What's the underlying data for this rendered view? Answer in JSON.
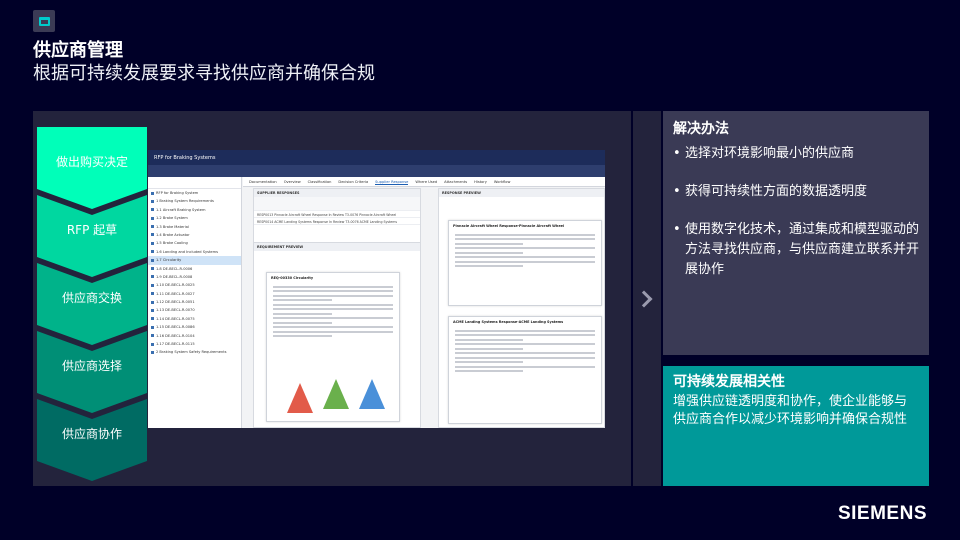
{
  "header": {
    "title": "供应商管理",
    "subtitle": "根据可持续发展要求寻找供应商并确保合规"
  },
  "process_steps": [
    {
      "label": "做出购买决定",
      "color": "#00ffb9"
    },
    {
      "label": "RFP 起草",
      "color": "#00d7a0"
    },
    {
      "label": "供应商交换",
      "color": "#00b38a"
    },
    {
      "label": "供应商选择",
      "color": "#008f76"
    },
    {
      "label": "供应商协作",
      "color": "#006b63"
    }
  ],
  "screenshot": {
    "app_title": "RFP for Braking Systems",
    "tabs": [
      "Documentation",
      "Overview",
      "Classification",
      "Decision Criteria",
      "Supplier Response",
      "Where Used",
      "Attachments",
      "History",
      "Workflow"
    ],
    "active_tab": "Supplier Response",
    "tree_items": [
      "RFP for Braking System",
      "1 Braking System Requirements",
      "1.1 Aircraft Braking System",
      "1.2 Brake System",
      "1.3 Brake Material",
      "1.4 Brake Actuator",
      "1.5 Brake Cooling",
      "1.6 Landing and Included Systems",
      "1.7 Circularity",
      "1.8 DE-BECL-R-0006",
      "1.9 DE-BECL-R-0008",
      "1.10 DE-BECL-R-0025",
      "1.11 DE-BECL-R-0027",
      "1.12 DE-BECL-R-0051",
      "1.13 DE-BECL-R-0070",
      "1.14 DE-BECL-R-0075",
      "1.15 DE-BECL-R-0086",
      "1.16 DE-BECL-R-0104",
      "1.17 DE-BECL-R-0115",
      "2 Braking System Safety Requirements"
    ],
    "selected_tree_index": 8,
    "supplier_pane_title": "SUPPLIER RESPONSES",
    "supplier_rows": [
      "RESP0013 Pinnacle Aircraft Wheel Response   In Review   T3-0076 Pinnacle Aircraft Wheel",
      "RESP0014 ACME Landing Systems Response   In Review   T3-0076 ACME Landing Systems"
    ],
    "req_pane_title": "REQUIREMENT PREVIEW",
    "req_doc_title": "REQ-00330 Circularity",
    "resp_pane_title": "RESPONSE PREVIEW",
    "resp_doc_1": "Pinnacle Aircraft Wheel Response-Pinnacle Aircraft Wheel",
    "resp_doc_2": "ACME Landing Systems Response-ACME Landing Systems"
  },
  "solution": {
    "heading": "解决办法",
    "bullets": [
      "选择对环境影响最小的供应商",
      "获得可持续性方面的数据透明度",
      "使用数字化技术，通过集成和模型驱动的方法寻找供应商，与供应商建立联系并开展协作"
    ]
  },
  "value": {
    "heading": "可持续发展相关性",
    "text": "增强供应链透明度和协作，使企业能够与供应商合作以减少环境影响并确保合规性"
  },
  "brand": "SIEMENS",
  "colors": {
    "background": "#000028",
    "panel": "#23233c",
    "solution_card": "#3a3a55",
    "value_card": "#009999"
  }
}
